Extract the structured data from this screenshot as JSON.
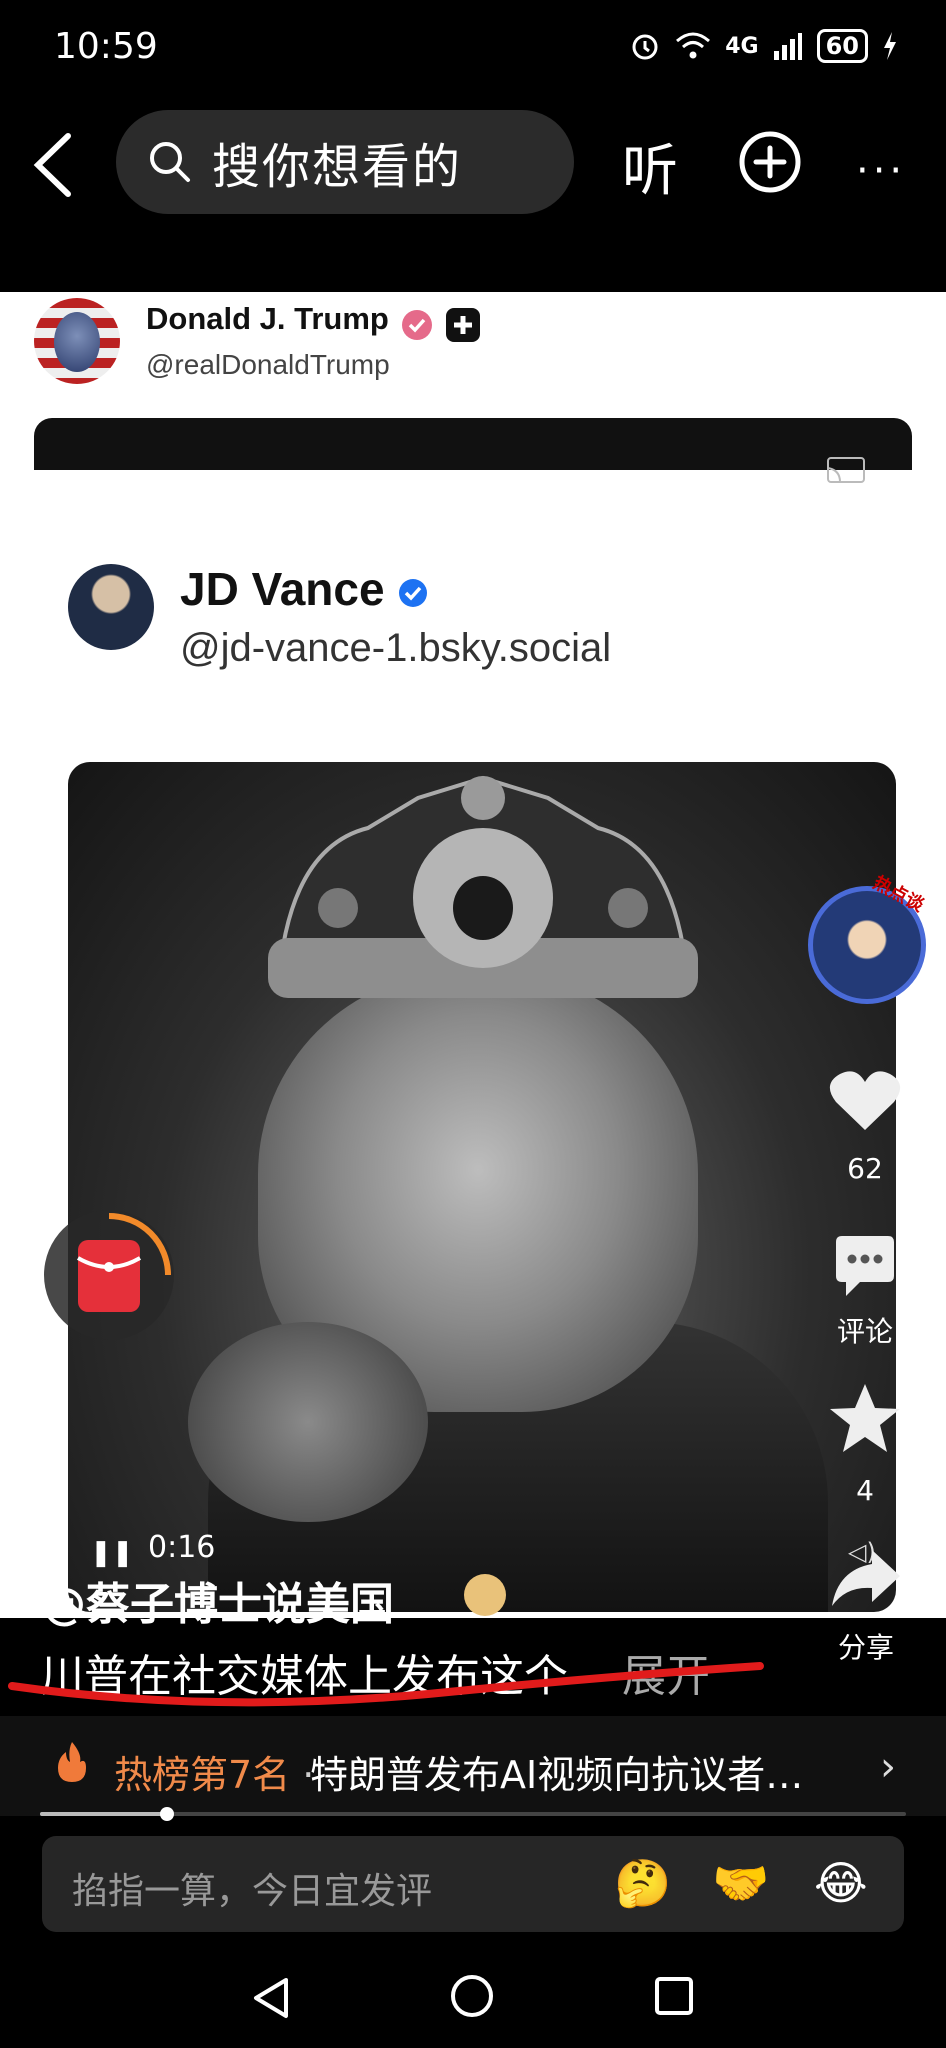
{
  "status_bar": {
    "time": "10:59",
    "network": "4G",
    "battery": "60",
    "icons": [
      "alarm-icon",
      "wifi-icon",
      "signal-icon",
      "battery-icon",
      "charging-icon"
    ]
  },
  "top_bar": {
    "search_placeholder": "搜你想看的",
    "listen_label": "听",
    "more_label": "···"
  },
  "post": {
    "author_name": "Donald J. Trump",
    "author_handle": "@realDonaldTrump",
    "embedded_name": "JD Vance",
    "embedded_handle": "@jd-vance-1.bsky.social",
    "video_time": "0:16"
  },
  "side_rail": {
    "creator_badge": "热点谈",
    "like_count": "62",
    "comment_label": "评论",
    "favorite_count": "4",
    "share_label": "分享"
  },
  "caption": {
    "author": "@蔡子博士说美国",
    "text": "川普在社交媒体上发布这个",
    "expand": "展开"
  },
  "hot_banner": {
    "rank": "热榜第7名",
    "separator": "·",
    "title": "特朗普发布AI视频向抗议者…"
  },
  "comment_bar": {
    "placeholder": "掐指一算，今日宜发评",
    "emojis": [
      "🤔",
      "🤝",
      "😂"
    ]
  },
  "colors": {
    "accent_orange": "#f08a4a",
    "verified_blue": "#1d72f2",
    "underline_red": "#e11b1b"
  }
}
